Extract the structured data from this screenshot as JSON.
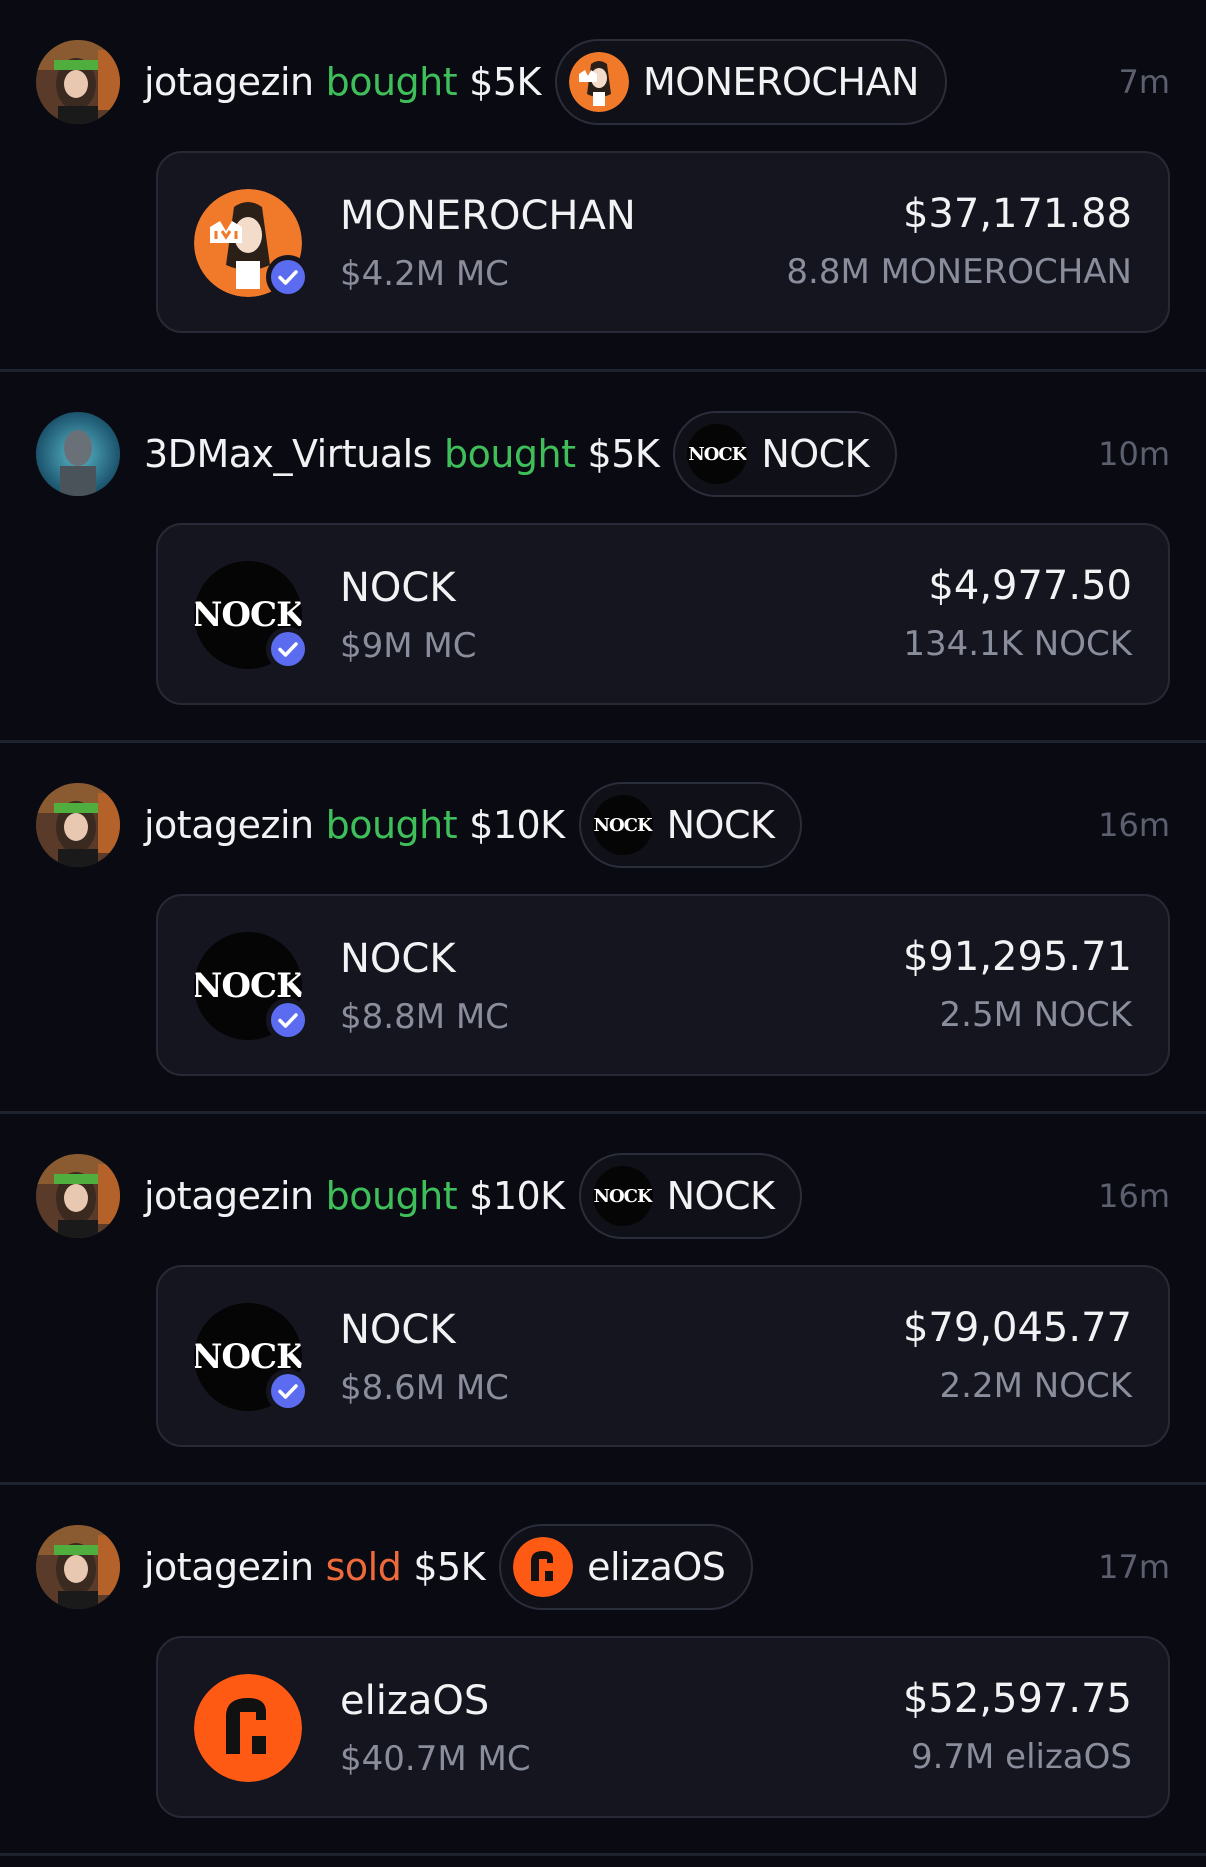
{
  "feed": [
    {
      "user": "jotagezin",
      "action": "bought",
      "action_type": "buy",
      "amount": "$5K",
      "token_name": "MONEROCHAN",
      "token_icon": "monerochan-icon",
      "time": "7m",
      "card": {
        "name": "MONEROCHAN",
        "mc": "$4.2M MC",
        "usd": "$37,171.88",
        "qty": "8.8M MONEROCHAN"
      }
    },
    {
      "user": "3DMax_Virtuals",
      "action": "bought",
      "action_type": "buy",
      "amount": "$5K",
      "token_name": "NOCK",
      "token_icon": "nock-icon",
      "time": "10m",
      "card": {
        "name": "NOCK",
        "mc": "$9M MC",
        "usd": "$4,977.50",
        "qty": "134.1K NOCK"
      }
    },
    {
      "user": "jotagezin",
      "action": "bought",
      "action_type": "buy",
      "amount": "$10K",
      "token_name": "NOCK",
      "token_icon": "nock-icon",
      "time": "16m",
      "card": {
        "name": "NOCK",
        "mc": "$8.8M MC",
        "usd": "$91,295.71",
        "qty": "2.5M NOCK"
      }
    },
    {
      "user": "jotagezin",
      "action": "bought",
      "action_type": "buy",
      "amount": "$10K",
      "token_name": "NOCK",
      "token_icon": "nock-icon",
      "time": "16m",
      "card": {
        "name": "NOCK",
        "mc": "$8.6M MC",
        "usd": "$79,045.77",
        "qty": "2.2M NOCK"
      }
    },
    {
      "user": "jotagezin",
      "action": "sold",
      "action_type": "sell",
      "amount": "$5K",
      "token_name": "elizaOS",
      "token_icon": "elizaos-icon",
      "time": "17m",
      "card": {
        "name": "elizaOS",
        "mc": "$40.7M MC",
        "usd": "$52,597.75",
        "qty": "9.7M elizaOS"
      }
    }
  ],
  "logo_text": {
    "nock": "NOCK"
  },
  "colors": {
    "background": "#0a0b12",
    "card": "#14151e",
    "buy": "#3fbf5a",
    "sell": "#ef6a3a",
    "muted": "#8a8e9c",
    "verified": "#5b6cf0"
  }
}
